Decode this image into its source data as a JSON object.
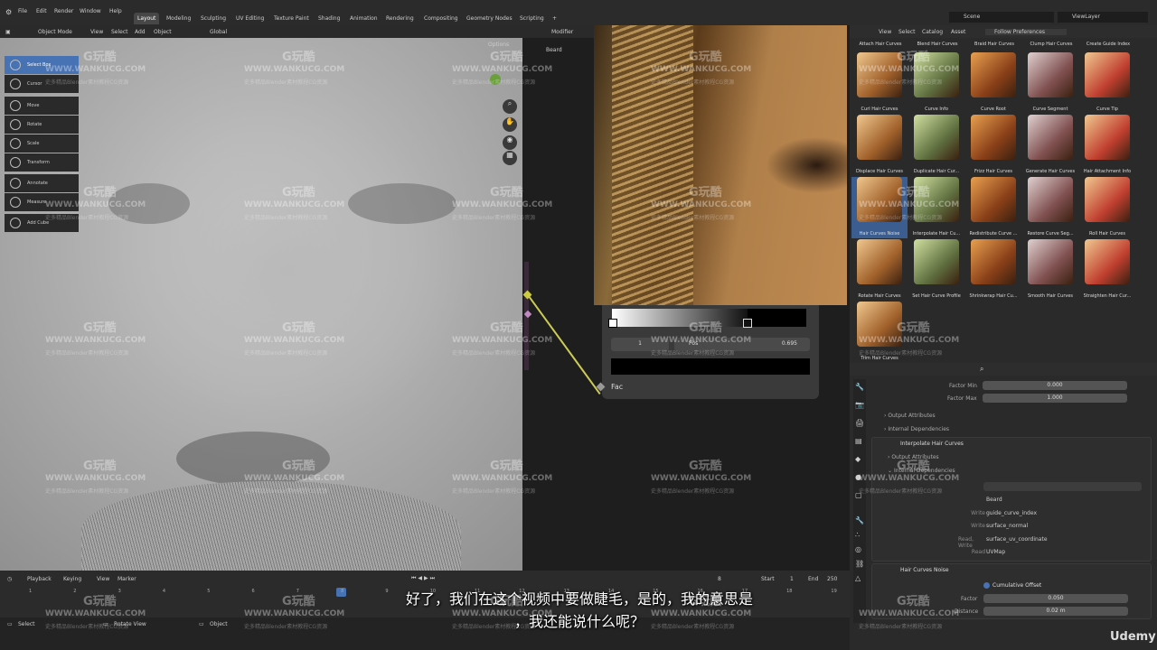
{
  "menu": [
    "File",
    "Edit",
    "Render",
    "Window",
    "Help"
  ],
  "workspaces": [
    "Layout",
    "Modeling",
    "Sculpting",
    "UV Editing",
    "Texture Paint",
    "Shading",
    "Animation",
    "Rendering",
    "Compositing",
    "Geometry Nodes",
    "Scripting"
  ],
  "scene": "Scene",
  "view_layer": "ViewLayer",
  "viewport": {
    "mode": "Object Mode",
    "view": "View",
    "select": "Select",
    "add": "Add",
    "object": "Object",
    "orientation": "Global",
    "options": "Options"
  },
  "tools": [
    "Select Box",
    "Cursor",
    "Move",
    "Rotate",
    "Scale",
    "Transform",
    "Annotate",
    "Measure",
    "Add Cube"
  ],
  "node_editor": {
    "modifier": "Modifier",
    "object": "Beard",
    "ramp_index": "1",
    "ramp_pos_label": "Pos",
    "ramp_pos_value": "0.695",
    "socket": "Fac"
  },
  "asset_browser": {
    "view": "View",
    "select": "Select",
    "catalog": "Catalog",
    "asset": "Asset",
    "prefs": "Follow Preferences",
    "top_row": [
      "Attach Hair Curves",
      "Blend Hair Curves",
      "Braid Hair Curves",
      "Clump Hair Curves",
      "Create Guide Index"
    ],
    "items": [
      "Curl Hair Curves",
      "Curve Info",
      "Curve Root",
      "Curve Segment",
      "Curve Tip",
      "Displace Hair Curves",
      "Duplicate Hair Cur...",
      "Frizz Hair Curves",
      "Generate Hair Curves",
      "Hair Attachment Info",
      "Hair Curves Noise",
      "Interpolate Hair Cu...",
      "Redistribute Curve ...",
      "Restore Curve Seg...",
      "Roll Hair Curves",
      "Rotate Hair Curves",
      "Set Hair Curve Profile",
      "Shrinkwrap Hair Cu...",
      "Smooth Hair Curves",
      "Straighten Hair Cur...",
      "Trim Hair Curves"
    ]
  },
  "properties": {
    "factor_min_label": "Factor Min",
    "factor_min": "0.000",
    "factor_max_label": "Factor Max",
    "factor_max": "1.000",
    "output_attributes": "Output Attributes",
    "internal_dependencies": "Internal Dependencies",
    "modifier2": "Interpolate Hair Curves",
    "write_rows": [
      {
        "k": "",
        "v": "Beard"
      },
      {
        "k": "Write",
        "v": "guide_curve_index"
      },
      {
        "k": "Write",
        "v": "surface_normal"
      },
      {
        "k": "Read, Write",
        "v": "surface_uv_coordinate"
      },
      {
        "k": "Read",
        "v": "UVMap"
      }
    ],
    "modifier3": "Hair Curves Noise",
    "cumulative": "Cumulative Offset",
    "factor_label": "Factor",
    "factor_val": "0.050",
    "distance_label": "Distance",
    "distance_val": "0.02 m"
  },
  "timeline": {
    "playback": "Playback",
    "keying": "Keying",
    "view": "View",
    "marker": "Marker",
    "frame": "8",
    "start_label": "Start",
    "start": "1",
    "end_label": "End",
    "end": "250",
    "ticks": [
      "1",
      "2",
      "3",
      "4",
      "5",
      "6",
      "7",
      "8",
      "9",
      "10",
      "11",
      "12",
      "13",
      "14",
      "15",
      "16",
      "17",
      "18",
      "19"
    ]
  },
  "status": {
    "select": "Select",
    "rotate": "Rotate View",
    "object": "Object"
  },
  "subtitle": {
    "line1": "好了，我们在这个视频中要做睫毛，是的，我的意思是",
    "line2": "，我还能说什么呢？"
  },
  "watermark": {
    "logo": "G玩酷",
    "url": "WWW.WANKUCG.COM",
    "tag": "史多精品Blender素材教程CG资源"
  },
  "brand": "Udemy"
}
